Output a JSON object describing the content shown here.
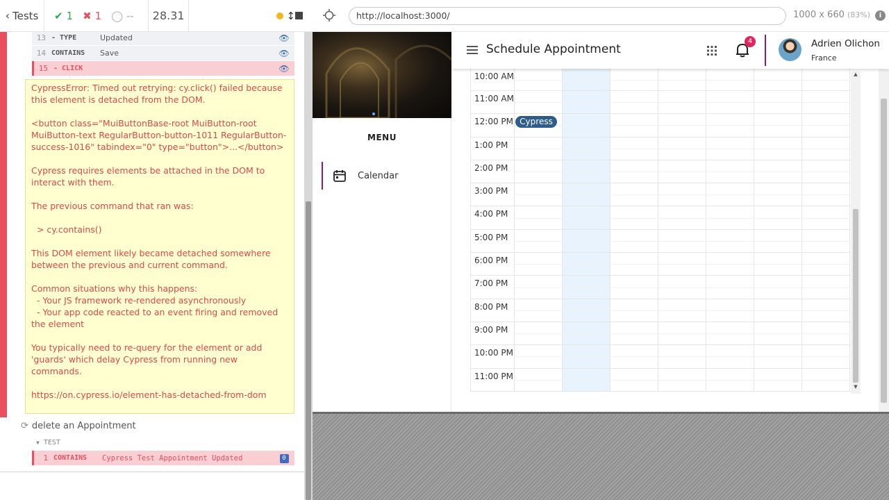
{
  "runner": {
    "tests_label": "Tests",
    "passed_count": "1",
    "failed_count": "1",
    "pending_count": "--",
    "duration": "28.31"
  },
  "commands": [
    {
      "num": "13",
      "name": "- TYPE",
      "message": "Updated",
      "state": "normal"
    },
    {
      "num": "14",
      "name": "CONTAINS",
      "message": "Save",
      "state": "normal"
    },
    {
      "num": "15",
      "name": "- CLICK",
      "message": "",
      "state": "failed"
    }
  ],
  "error": {
    "p1": "CypressError: Timed out retrying: cy.click() failed because this element is detached from the DOM.",
    "p2": "<button class=\"MuiButtonBase-root MuiButton-root MuiButton-text RegularButton-button-1011 RegularButton-success-1016\" tabindex=\"0\" type=\"button\">...</button>",
    "p3": "Cypress requires elements be attached in the DOM to interact with them.",
    "p4": "The previous command that ran was:",
    "p5": "  > cy.contains()",
    "p6": "This DOM element likely became detached somewhere between the previous and current command.",
    "p7": "Common situations why this happens:\n  - Your JS framework re-rendered asynchronously\n  - Your app code reacted to an event firing and removed the element",
    "p8": "You typically need to re-query for the element or add 'guards' which delay Cypress from running new commands.",
    "p9": "https://on.cypress.io/element-has-detached-from-dom"
  },
  "next_test": {
    "title": "delete an Appointment",
    "hook": "TEST",
    "command_num": "1",
    "command_name": "CONTAINS",
    "command_message": "Cypress Test Appointment Updated",
    "badge": "0"
  },
  "urlbar": {
    "url": "http://localhost:3000/",
    "viewport": "1000 x 660",
    "scale": "(83%)"
  },
  "app": {
    "menu_label": "MENU",
    "nav_calendar": "Calendar",
    "title": "Schedule Appointment",
    "notification_count": "4",
    "user_name": "Adrien Olichon",
    "user_country": "France",
    "appointment_label": "Cypress",
    "time_slots": [
      "10:00 AM",
      "11:00 AM",
      "12:00 PM",
      "1:00 PM",
      "2:00 PM",
      "3:00 PM",
      "4:00 PM",
      "5:00 PM",
      "6:00 PM",
      "7:00 PM",
      "8:00 PM",
      "9:00 PM",
      "10:00 PM",
      "11:00 PM"
    ]
  },
  "colors": {
    "fail": "#e94f5f",
    "pass": "#2fa84f",
    "accent_purple": "#8e1c6c",
    "appointment": "#2e5c8f",
    "today_column": "#e8f3fd",
    "badge": "#e0245e"
  }
}
